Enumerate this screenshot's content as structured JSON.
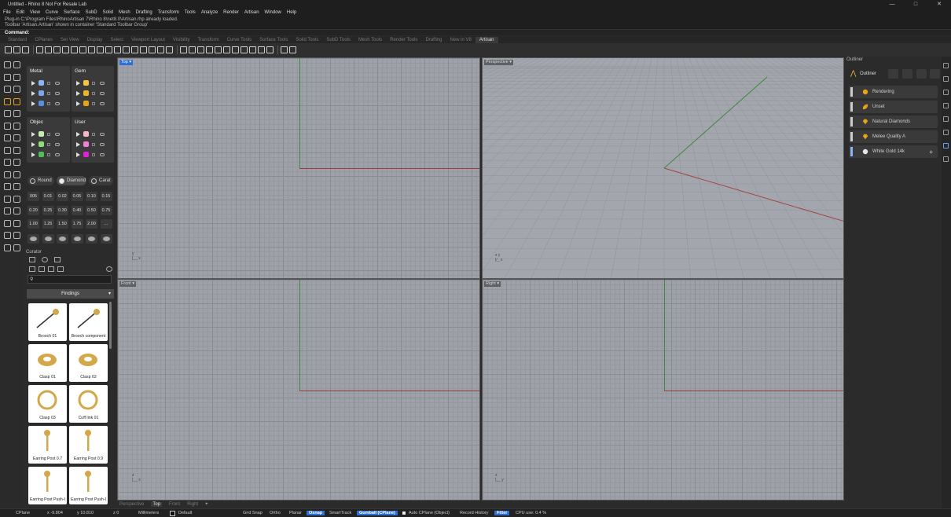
{
  "window": {
    "title": "Untitled - Rhino 8 Not For Resale Lab",
    "minimize": "—",
    "maximize": "□",
    "close": "✕"
  },
  "menu": [
    "File",
    "Edit",
    "View",
    "Curve",
    "Surface",
    "SubD",
    "Solid",
    "Mesh",
    "Drafting",
    "Transform",
    "Tools",
    "Analyze",
    "Render",
    "Artisan",
    "Window",
    "Help"
  ],
  "command": {
    "history": [
      "Plug-in C:\\Program Files\\RhinoArtisan 7\\Rhino 8\\net8.0\\Artisan.rhp already loaded.",
      "Toolbar 'Artisan.Artisan' shown in container 'Standard Toolbar Group'"
    ],
    "prompt": "Command:"
  },
  "toolbar_tabs": [
    "Standard",
    "CPlanes",
    "Set View",
    "Display",
    "Select",
    "Viewport Layout",
    "Visibility",
    "Transform",
    "Curve Tools",
    "Surface Tools",
    "Solid Tools",
    "SubD Tools",
    "Mesh Tools",
    "Render Tools",
    "Drafting",
    "New in V8",
    "Artisan"
  ],
  "active_toolbar_tab": "Artisan",
  "layers": {
    "groups": [
      {
        "name": "Metal",
        "colors": [
          "#8ab4f8",
          "#7aa6ee",
          "#5b8de0"
        ]
      },
      {
        "name": "Gem",
        "colors": [
          "#f5c542",
          "#f0b429",
          "#e8a317"
        ]
      },
      {
        "name": "Objec",
        "colors": [
          "#bff0b0",
          "#8fe07a",
          "#4fbf5a"
        ]
      },
      {
        "name": "User",
        "colors": [
          "#f6b6c8",
          "#f07fd6",
          "#e020e0"
        ]
      }
    ]
  },
  "gem": {
    "shapes": [
      "Round",
      "Diamond",
      "Carat"
    ],
    "sizes": [
      [
        "005",
        "0.01",
        "0.02",
        "0.05",
        "0.10",
        "0.15"
      ],
      [
        "0.20",
        "0.25",
        "0.30",
        "0.40",
        "0.50",
        "0.75"
      ],
      [
        "1.00",
        "1.25",
        "1.50",
        "1.75",
        "2.00",
        "…"
      ]
    ]
  },
  "curator": {
    "title": "Curator",
    "search_placeholder": "",
    "category": "Findings",
    "items": [
      "Brooch 01",
      "Brooch component",
      "Clasp 01",
      "Clasp 02",
      "Clasp 03",
      "Cuff link 01",
      "Earring Post 0.7",
      "Earring Post 0.9",
      "Earring Post Push-I",
      "Earring Post Push-I"
    ]
  },
  "viewports": {
    "top": "Top",
    "perspective": "Perspective",
    "front": "Front",
    "right": "Right"
  },
  "viewport_tabs": [
    "Perspective",
    "Top",
    "Front",
    "Right",
    "+"
  ],
  "active_viewport_tab": "Top",
  "outliner": {
    "title": "Outliner",
    "header": "Outliner",
    "items": [
      "Rendering",
      "Unset",
      "Natural Diamonds",
      "Melee Quality A",
      "White Gold 14k"
    ],
    "add_label": "+"
  },
  "status": {
    "cplane": "CPlane",
    "x": "x -9.804",
    "y": "y 10.810",
    "z": "z 0",
    "units": "Millimeters",
    "layer": "Default",
    "grid_snap": "Grid Snap",
    "ortho": "Ortho",
    "planar": "Planar",
    "osnap": "Osnap",
    "smarttrack": "SmartTrack",
    "gumball": "Gumball (CPlane)",
    "auto_cplane": "Auto CPlane (Object)",
    "record_history": "Record History",
    "filter": "Filter",
    "cpu": "CPU use: 0.4 %"
  }
}
